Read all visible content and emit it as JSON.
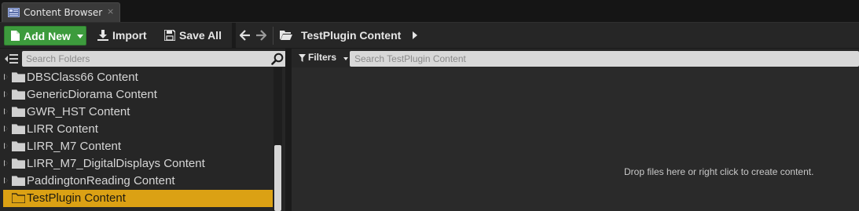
{
  "tab": {
    "title": "Content Browser",
    "close_glyph": "×",
    "icon": "content-browser-icon"
  },
  "toolbar": {
    "add_new_label": "Add New",
    "import_label": "Import",
    "save_all_label": "Save All",
    "path": {
      "current": "TestPlugin Content"
    }
  },
  "sources": {
    "search_placeholder": "Search Folders",
    "folders": [
      {
        "name": "DBSClass66 Content"
      },
      {
        "name": "GenericDiorama Content"
      },
      {
        "name": "GWR_HST Content"
      },
      {
        "name": "LIRR Content"
      },
      {
        "name": "LIRR_M7 Content"
      },
      {
        "name": "LIRR_M7_DigitalDisplays Content"
      },
      {
        "name": "PaddingtonReading Content"
      },
      {
        "name": "TestPlugin Content",
        "selected": true
      }
    ]
  },
  "assets": {
    "filters_label": "Filters",
    "search_placeholder": "Search TestPlugin Content",
    "empty_message": "Drop files here or right click to create content."
  },
  "colors": {
    "accent_green": "#3d9b3d",
    "selection": "#dba114",
    "panel": "#262626"
  }
}
